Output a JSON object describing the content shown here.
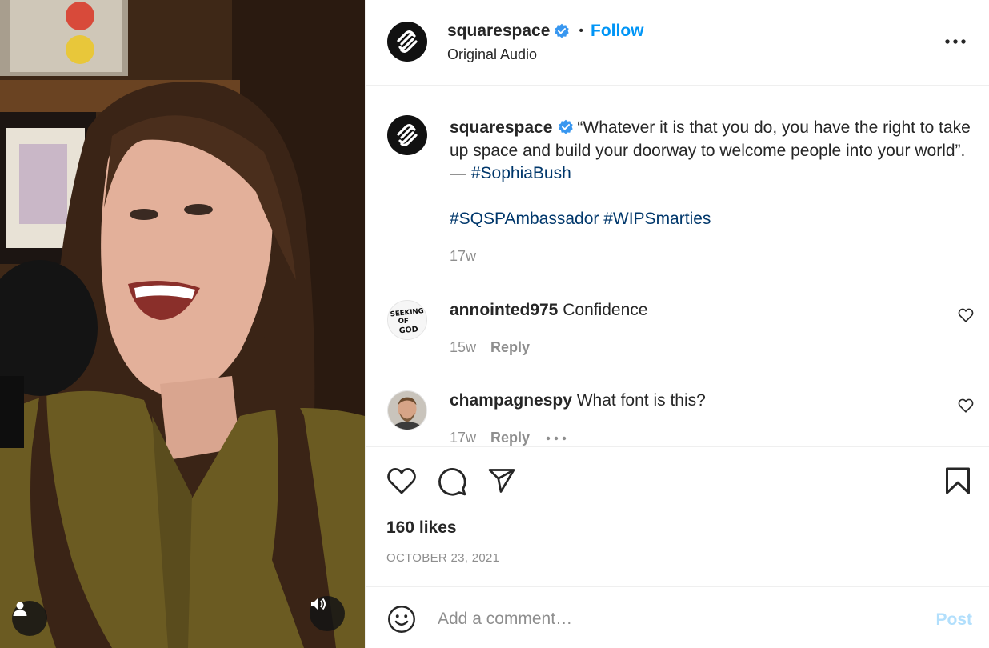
{
  "post": {
    "author": "squarespace",
    "verified": true,
    "follow_label": "Follow",
    "separator": "•",
    "audio_label": "Original Audio",
    "more_icon": "more-horizontal-icon"
  },
  "caption": {
    "username": "squarespace",
    "text": "“Whatever it is that you do, you have the right to take up space and build your doorway to welcome people into your world”. — ",
    "tag_inline": "#SophiaBush",
    "tags_line": [
      "#SQSPAmbassador",
      "#WIPSmarties"
    ],
    "time": "17w"
  },
  "comments": [
    {
      "username": "annointed975",
      "text": "Confidence",
      "time": "15w",
      "reply_label": "Reply",
      "avatar_text": "SEEKING OF GOD"
    },
    {
      "username": "champagnespy",
      "text": "What font is this?",
      "time": "17w",
      "reply_label": "Reply"
    }
  ],
  "actions": {
    "likes": "160 likes",
    "date": "OCTOBER 23, 2021"
  },
  "compose": {
    "placeholder": "Add a comment…",
    "post_label": "Post"
  },
  "colors": {
    "accent": "#0095f6",
    "hashtag": "#00376b",
    "muted": "#8e8e8e",
    "post_disabled": "#b2dffc",
    "verified": "#3897f0"
  }
}
